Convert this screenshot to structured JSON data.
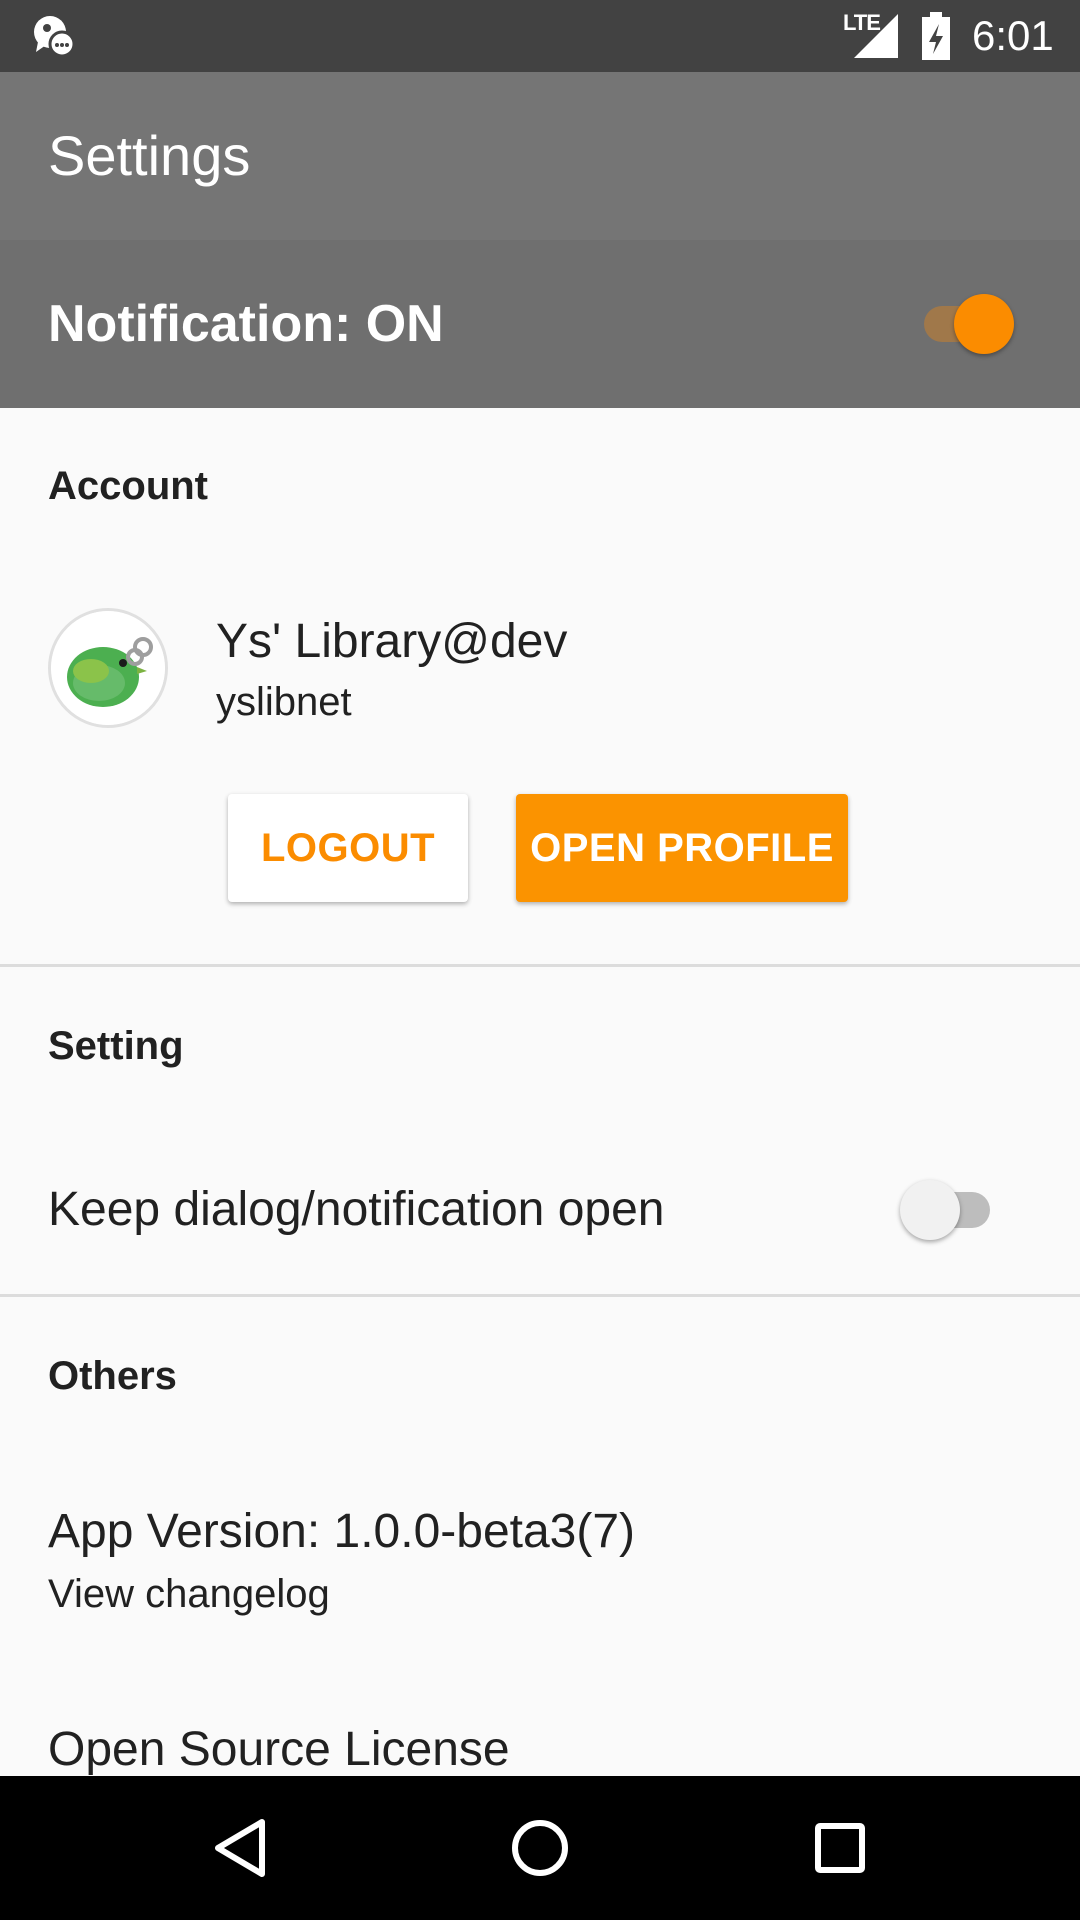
{
  "status_bar": {
    "network": "LTE",
    "time": "6:01"
  },
  "toolbar": {
    "title": "Settings"
  },
  "master_switch": {
    "label": "Notification: ON",
    "checked": true
  },
  "account": {
    "header": "Account",
    "name": "Ys' Library@dev",
    "username": "yslibnet",
    "logout_label": "LOGOUT",
    "open_profile_label": "OPEN PROFILE"
  },
  "setting": {
    "header": "Setting",
    "keep_open_label": "Keep dialog/notification open",
    "keep_open_checked": false
  },
  "others": {
    "header": "Others",
    "app_version_title": "App Version: 1.0.0-beta3(7)",
    "app_version_summary": "View changelog",
    "license_title": "Open Source License"
  },
  "colors": {
    "accent": "#fb8c00",
    "toolbar": "#757575",
    "status_bar": "#424242"
  }
}
